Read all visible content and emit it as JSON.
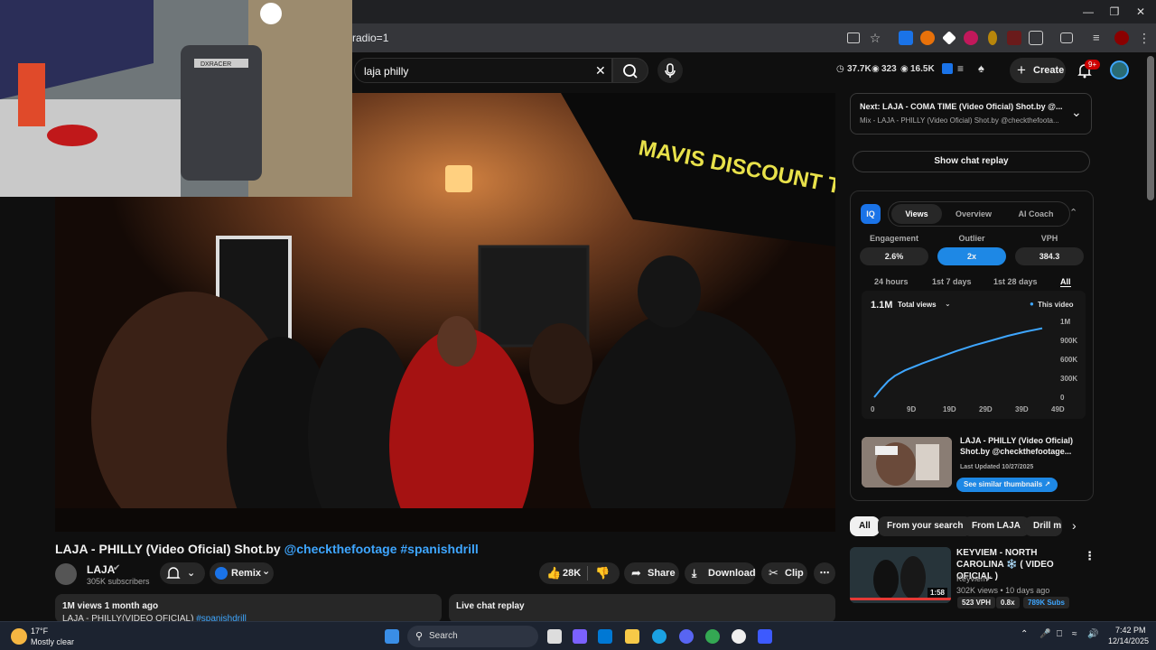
{
  "browser": {
    "url_fragment": "radio=1",
    "window_controls": [
      "minimize-icon",
      "maximize-icon",
      "close-icon"
    ]
  },
  "header": {
    "search_value": "laja philly",
    "stats": [
      "37.7K",
      "323",
      "16.5K"
    ],
    "create_label": "Create",
    "notifications_badge": "9+"
  },
  "video": {
    "title_main": "LAJA - PHILLY (Video Oficial) Shot.by ",
    "title_mention": "@checkthefootage",
    "title_tag": "#spanishdrill",
    "sign_text": "MAVIS DISCOUNT TIRE",
    "chair_text": "DXRACER"
  },
  "channel": {
    "name": "LAJA",
    "subscribers": "305K subscribers",
    "remix_label": "Remix"
  },
  "actions": {
    "likes": "28K",
    "share": "Share",
    "download": "Download",
    "clip": "Clip"
  },
  "description": {
    "meta": "1M views  1 month ago",
    "line": "LAJA - PHILLY(VIDEO OFICIAL) ",
    "tag": "#spanishdrill"
  },
  "live_chat": {
    "label": "Live chat replay"
  },
  "next": {
    "title": "Next: LAJA - COMA TIME (Video Oficial) Shot.by @...",
    "subtitle": "Mix - LAJA - PHILLY (Video Oficial) Shot.by @checkthefoota..."
  },
  "show_chat_replay": "Show chat replay",
  "iq": {
    "logo": "IQ",
    "tabs": [
      "Views",
      "Overview",
      "AI Coach"
    ],
    "metrics": [
      {
        "label": "Engagement",
        "value": "2.6%"
      },
      {
        "label": "Outlier",
        "value": "2x"
      },
      {
        "label": "VPH",
        "value": "384.3"
      }
    ],
    "ranges": [
      "24 hours",
      "1st 7 days",
      "1st 28 days",
      "All"
    ],
    "total": "1.1M",
    "total_select": "Total views",
    "legend": "This video",
    "thumb_title": "LAJA - PHILLY (Video Oficial) Shot.by @checkthefootage...",
    "last_updated": "Last Updated 10/27/2025",
    "similar_label": "See similar thumbnails"
  },
  "chart_data": {
    "type": "line",
    "x": [
      0,
      2,
      4,
      6,
      9,
      14,
      19,
      24,
      29,
      34,
      39,
      44,
      49
    ],
    "xticks": [
      "0",
      "9D",
      "19D",
      "29D",
      "39D",
      "49D"
    ],
    "yticks": [
      "1M",
      "900K",
      "600K",
      "300K",
      "0"
    ],
    "series": [
      {
        "name": "This video",
        "values": [
          0,
          120000,
          230000,
          310000,
          390000,
          490000,
          580000,
          670000,
          750000,
          820000,
          890000,
          950000,
          1000000
        ]
      }
    ],
    "ylim": [
      0,
      1100000
    ],
    "color": "#3ea6ff"
  },
  "chips": [
    "All",
    "From your search",
    "From LAJA",
    "Drill m"
  ],
  "rec": {
    "title": "KEYVIEM - NORTH CAROLINA ❄️ ( VIDEO OFICIAL )",
    "channel": "Keyviem",
    "meta": "302K views • 10 days ago",
    "duration": "1:58",
    "badges": [
      "523 VPH",
      "0.8x",
      "789K Subs"
    ]
  },
  "taskbar": {
    "temp": "17°F",
    "weather": "Mostly clear",
    "search": "Search",
    "time": "7:42 PM",
    "date": "12/14/2025"
  }
}
